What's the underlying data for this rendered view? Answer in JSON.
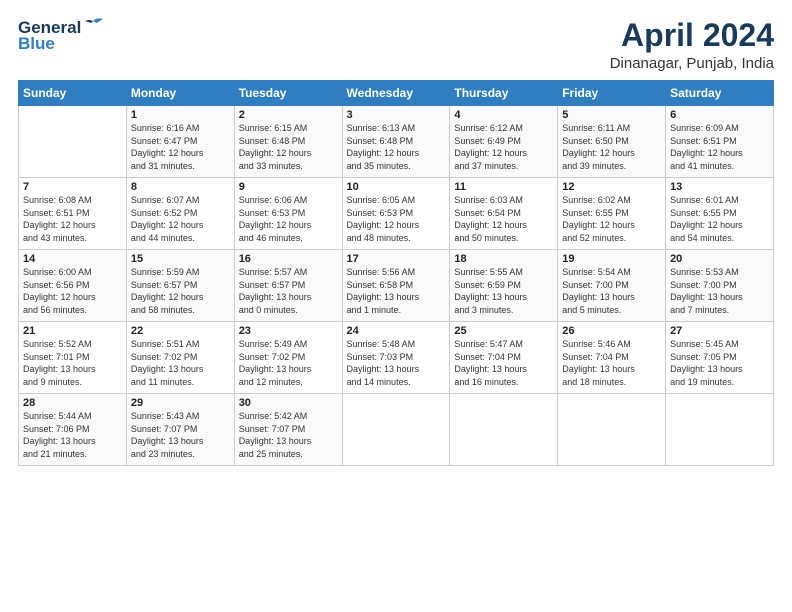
{
  "header": {
    "logo_line1": "General",
    "logo_line2": "Blue",
    "title": "April 2024",
    "subtitle": "Dinanagar, Punjab, India"
  },
  "days_of_week": [
    "Sunday",
    "Monday",
    "Tuesday",
    "Wednesday",
    "Thursday",
    "Friday",
    "Saturday"
  ],
  "weeks": [
    [
      {
        "day": "",
        "info": ""
      },
      {
        "day": "1",
        "info": "Sunrise: 6:16 AM\nSunset: 6:47 PM\nDaylight: 12 hours\nand 31 minutes."
      },
      {
        "day": "2",
        "info": "Sunrise: 6:15 AM\nSunset: 6:48 PM\nDaylight: 12 hours\nand 33 minutes."
      },
      {
        "day": "3",
        "info": "Sunrise: 6:13 AM\nSunset: 6:48 PM\nDaylight: 12 hours\nand 35 minutes."
      },
      {
        "day": "4",
        "info": "Sunrise: 6:12 AM\nSunset: 6:49 PM\nDaylight: 12 hours\nand 37 minutes."
      },
      {
        "day": "5",
        "info": "Sunrise: 6:11 AM\nSunset: 6:50 PM\nDaylight: 12 hours\nand 39 minutes."
      },
      {
        "day": "6",
        "info": "Sunrise: 6:09 AM\nSunset: 6:51 PM\nDaylight: 12 hours\nand 41 minutes."
      }
    ],
    [
      {
        "day": "7",
        "info": "Sunrise: 6:08 AM\nSunset: 6:51 PM\nDaylight: 12 hours\nand 43 minutes."
      },
      {
        "day": "8",
        "info": "Sunrise: 6:07 AM\nSunset: 6:52 PM\nDaylight: 12 hours\nand 44 minutes."
      },
      {
        "day": "9",
        "info": "Sunrise: 6:06 AM\nSunset: 6:53 PM\nDaylight: 12 hours\nand 46 minutes."
      },
      {
        "day": "10",
        "info": "Sunrise: 6:05 AM\nSunset: 6:53 PM\nDaylight: 12 hours\nand 48 minutes."
      },
      {
        "day": "11",
        "info": "Sunrise: 6:03 AM\nSunset: 6:54 PM\nDaylight: 12 hours\nand 50 minutes."
      },
      {
        "day": "12",
        "info": "Sunrise: 6:02 AM\nSunset: 6:55 PM\nDaylight: 12 hours\nand 52 minutes."
      },
      {
        "day": "13",
        "info": "Sunrise: 6:01 AM\nSunset: 6:55 PM\nDaylight: 12 hours\nand 54 minutes."
      }
    ],
    [
      {
        "day": "14",
        "info": "Sunrise: 6:00 AM\nSunset: 6:56 PM\nDaylight: 12 hours\nand 56 minutes."
      },
      {
        "day": "15",
        "info": "Sunrise: 5:59 AM\nSunset: 6:57 PM\nDaylight: 12 hours\nand 58 minutes."
      },
      {
        "day": "16",
        "info": "Sunrise: 5:57 AM\nSunset: 6:57 PM\nDaylight: 13 hours\nand 0 minutes."
      },
      {
        "day": "17",
        "info": "Sunrise: 5:56 AM\nSunset: 6:58 PM\nDaylight: 13 hours\nand 1 minute."
      },
      {
        "day": "18",
        "info": "Sunrise: 5:55 AM\nSunset: 6:59 PM\nDaylight: 13 hours\nand 3 minutes."
      },
      {
        "day": "19",
        "info": "Sunrise: 5:54 AM\nSunset: 7:00 PM\nDaylight: 13 hours\nand 5 minutes."
      },
      {
        "day": "20",
        "info": "Sunrise: 5:53 AM\nSunset: 7:00 PM\nDaylight: 13 hours\nand 7 minutes."
      }
    ],
    [
      {
        "day": "21",
        "info": "Sunrise: 5:52 AM\nSunset: 7:01 PM\nDaylight: 13 hours\nand 9 minutes."
      },
      {
        "day": "22",
        "info": "Sunrise: 5:51 AM\nSunset: 7:02 PM\nDaylight: 13 hours\nand 11 minutes."
      },
      {
        "day": "23",
        "info": "Sunrise: 5:49 AM\nSunset: 7:02 PM\nDaylight: 13 hours\nand 12 minutes."
      },
      {
        "day": "24",
        "info": "Sunrise: 5:48 AM\nSunset: 7:03 PM\nDaylight: 13 hours\nand 14 minutes."
      },
      {
        "day": "25",
        "info": "Sunrise: 5:47 AM\nSunset: 7:04 PM\nDaylight: 13 hours\nand 16 minutes."
      },
      {
        "day": "26",
        "info": "Sunrise: 5:46 AM\nSunset: 7:04 PM\nDaylight: 13 hours\nand 18 minutes."
      },
      {
        "day": "27",
        "info": "Sunrise: 5:45 AM\nSunset: 7:05 PM\nDaylight: 13 hours\nand 19 minutes."
      }
    ],
    [
      {
        "day": "28",
        "info": "Sunrise: 5:44 AM\nSunset: 7:06 PM\nDaylight: 13 hours\nand 21 minutes."
      },
      {
        "day": "29",
        "info": "Sunrise: 5:43 AM\nSunset: 7:07 PM\nDaylight: 13 hours\nand 23 minutes."
      },
      {
        "day": "30",
        "info": "Sunrise: 5:42 AM\nSunset: 7:07 PM\nDaylight: 13 hours\nand 25 minutes."
      },
      {
        "day": "",
        "info": ""
      },
      {
        "day": "",
        "info": ""
      },
      {
        "day": "",
        "info": ""
      },
      {
        "day": "",
        "info": ""
      }
    ]
  ]
}
